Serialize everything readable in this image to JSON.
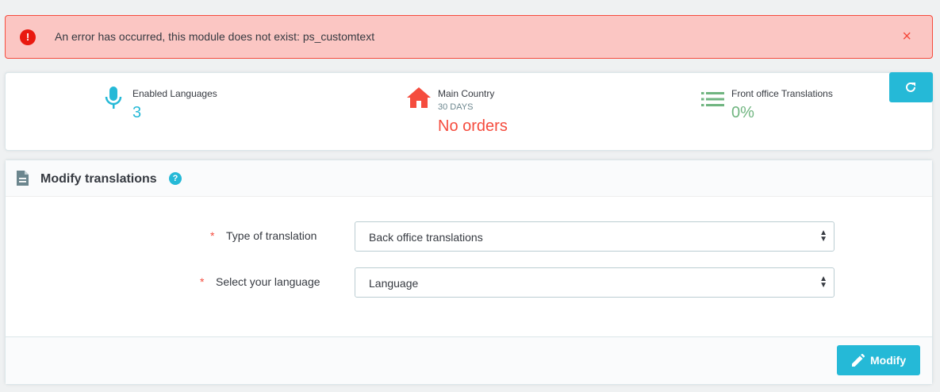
{
  "alert": {
    "message": "An error has occurred, this module does not exist: ps_customtext",
    "icon": "exclamation-icon",
    "close_symbol": "×"
  },
  "kpis": [
    {
      "icon": "microphone-icon",
      "label": "Enabled Languages",
      "sub": "",
      "value": "3",
      "color": "#25b9d7"
    },
    {
      "icon": "home-icon",
      "label": "Main Country",
      "sub": "30 DAYS",
      "value": "No orders",
      "color": "#f54c3e"
    },
    {
      "icon": "list-icon",
      "label": "Front office Translations",
      "sub": "",
      "value": "0%",
      "color": "#70b580"
    }
  ],
  "refresh": {
    "icon": "refresh-icon"
  },
  "panel": {
    "title": "Modify translations",
    "help_symbol": "?",
    "fields": [
      {
        "required_mark": "*",
        "label": "Type of translation",
        "value": "Back office translations"
      },
      {
        "required_mark": "*",
        "label": "Select your language",
        "value": "Language"
      }
    ],
    "submit_label": "Modify"
  },
  "colors": {
    "accent": "#25b9d7",
    "danger": "#f54c3e",
    "success": "#70b580"
  }
}
